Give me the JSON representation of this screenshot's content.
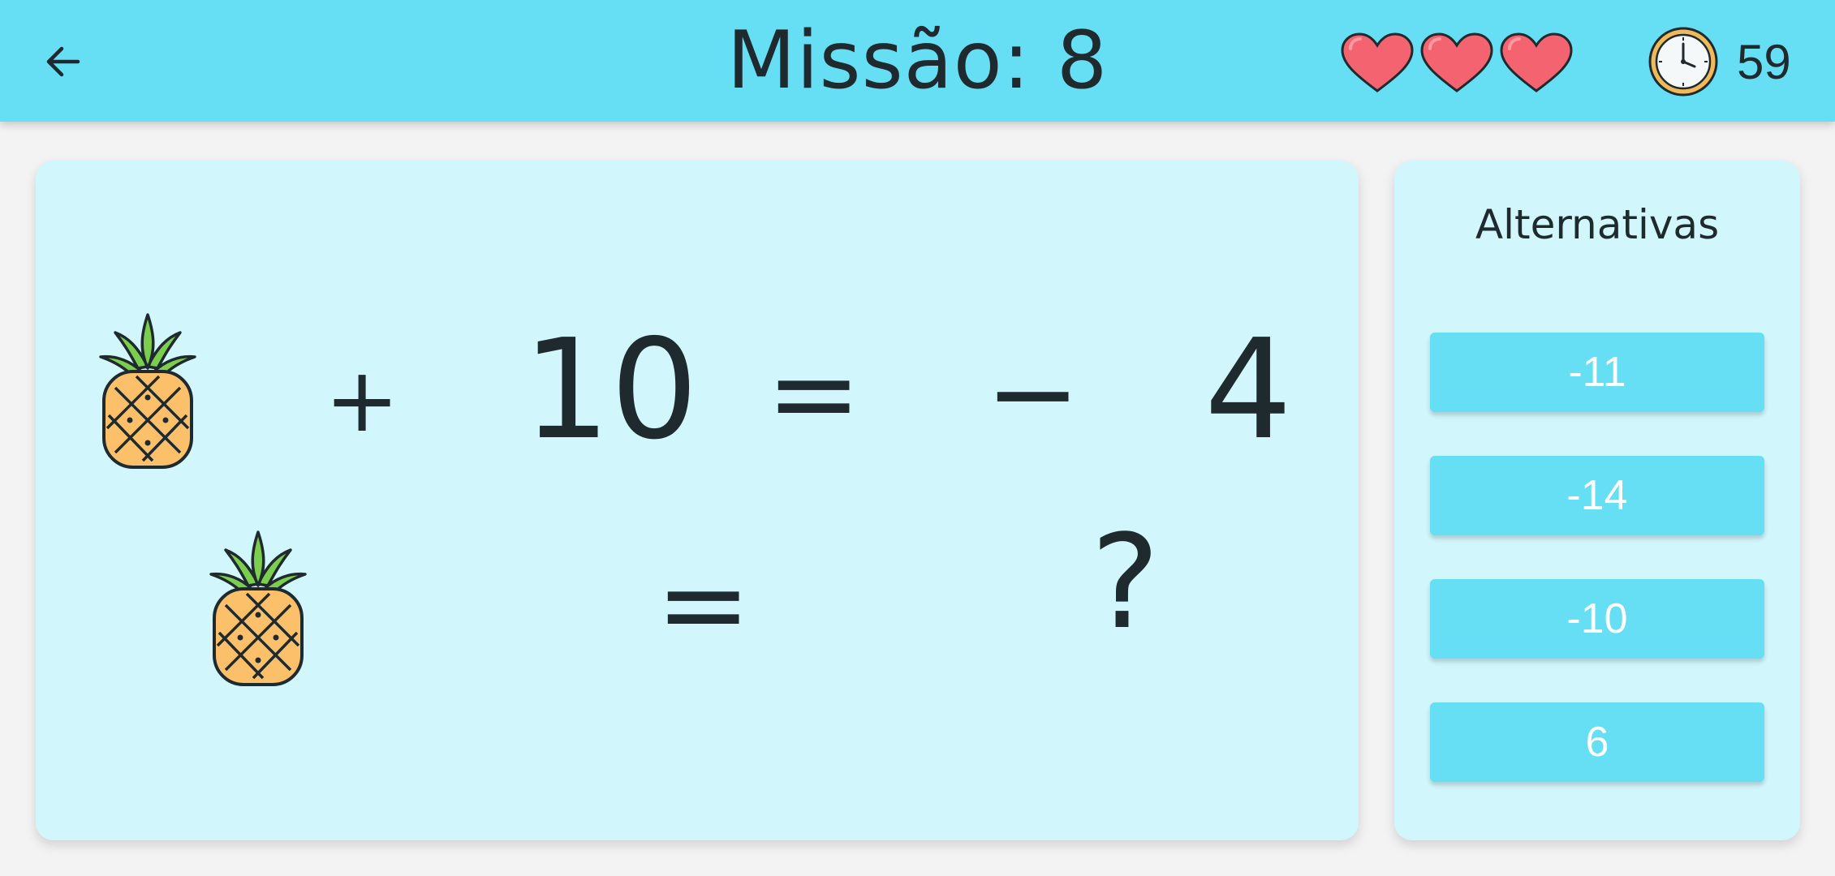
{
  "header": {
    "title_label": "Missão:",
    "mission_number": "8",
    "lives": 3,
    "timer_value": "59",
    "background_color": "#66dff5"
  },
  "icons": {
    "back": "arrow-left-icon",
    "life": "heart-icon",
    "timer": "clock-icon",
    "variable": "pineapple-icon"
  },
  "equation": {
    "row1": {
      "variable": "pineapple",
      "operator": "+",
      "operand": "10",
      "equals": "=",
      "result_sign": "−",
      "result_value": "4"
    },
    "row2": {
      "variable": "pineapple",
      "equals": "=",
      "unknown": "?"
    }
  },
  "answers": {
    "title": "Alternativas",
    "options": [
      "-11",
      "-14",
      "-10",
      "6"
    ]
  }
}
